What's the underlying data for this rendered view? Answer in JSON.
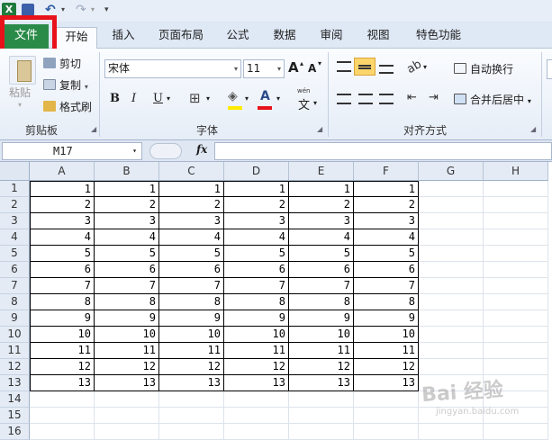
{
  "qat": {
    "logo": "X",
    "undo_glyph": "↶",
    "redo_glyph": "↷",
    "dropdown_glyph": "▾",
    "customize_glyph": "▾"
  },
  "tabs": [
    "文件",
    "开始",
    "插入",
    "页面布局",
    "公式",
    "数据",
    "审阅",
    "视图",
    "特色功能"
  ],
  "ribbon": {
    "clipboard": {
      "paste": "粘贴",
      "cut": "剪切",
      "copy": "复制",
      "format_painter": "格式刷",
      "group_label": "剪贴板"
    },
    "font": {
      "font_name": "宋体",
      "font_size": "11",
      "grow": "A",
      "shrink": "A",
      "bold": "B",
      "italic": "I",
      "underline": "U",
      "border_glyph": "⊞",
      "fill_glyph": "◈",
      "color_glyph": "A",
      "phonetic": "wén",
      "phonetic_char": "文",
      "group_label": "字体"
    },
    "alignment": {
      "wrap_text": "自动换行",
      "merge_center": "合并后居中",
      "group_label": "对齐方式"
    },
    "colors": {
      "file_tab": "#2a8b48",
      "highlight_marker": "#e8121b",
      "fill_yellow": "#ffeb00",
      "font_red": "#e8121b",
      "active_align": "#fcd56b"
    }
  },
  "formula_bar": {
    "name_box": "M17",
    "fx": "fx",
    "formula": ""
  },
  "sheet": {
    "columns": [
      "A",
      "B",
      "C",
      "D",
      "E",
      "F",
      "G",
      "H"
    ],
    "row_numbers": [
      "1",
      "2",
      "3",
      "4",
      "5",
      "6",
      "7",
      "8",
      "9",
      "10",
      "11",
      "12",
      "13",
      "14",
      "15",
      "16"
    ],
    "rows": [
      [
        "1",
        "1",
        "1",
        "1",
        "1",
        "1"
      ],
      [
        "2",
        "2",
        "2",
        "2",
        "2",
        "2"
      ],
      [
        "3",
        "3",
        "3",
        "3",
        "3",
        "3"
      ],
      [
        "4",
        "4",
        "4",
        "4",
        "4",
        "4"
      ],
      [
        "5",
        "5",
        "5",
        "5",
        "5",
        "5"
      ],
      [
        "6",
        "6",
        "6",
        "6",
        "6",
        "6"
      ],
      [
        "7",
        "7",
        "7",
        "7",
        "7",
        "7"
      ],
      [
        "8",
        "8",
        "8",
        "8",
        "8",
        "8"
      ],
      [
        "9",
        "9",
        "9",
        "9",
        "9",
        "9"
      ],
      [
        "10",
        "10",
        "10",
        "10",
        "10",
        "10"
      ],
      [
        "11",
        "11",
        "11",
        "11",
        "11",
        "11"
      ],
      [
        "12",
        "12",
        "12",
        "12",
        "12",
        "12"
      ],
      [
        "13",
        "13",
        "13",
        "13",
        "13",
        "13"
      ]
    ]
  },
  "watermark": {
    "text": "Bai 经验",
    "sub": "jingyan.baidu.com"
  }
}
